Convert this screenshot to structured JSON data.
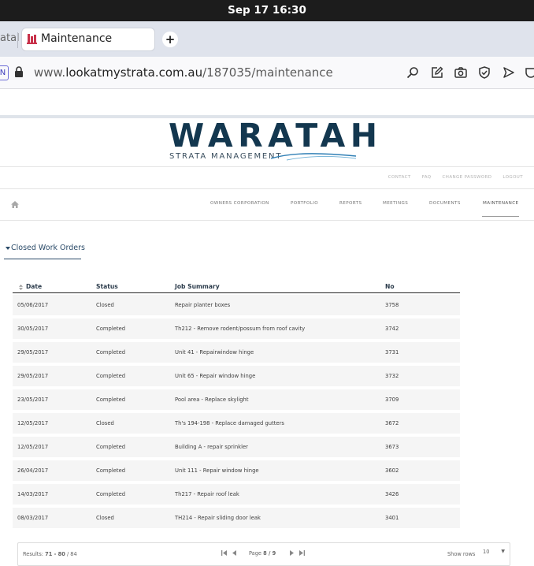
{
  "os": {
    "datetime": "Sep 17  16:30"
  },
  "browser": {
    "prev_tab_fragment": "atal",
    "active_tab_title": "Maintenance",
    "new_tab_symbol": "+",
    "url_prefix": "www.",
    "url_domain": "lookatmystrata.com.au",
    "url_path": "/187035/maintenance",
    "extension_badge": "N"
  },
  "brand": {
    "name": "WARATAH",
    "tagline": "STRATA MANAGEMENT",
    "accent": "#13374f"
  },
  "util_nav": [
    "CONTACT",
    "FAQ",
    "CHANGE PASSWORD",
    "LOGOUT"
  ],
  "main_nav": {
    "items": [
      "OWNERS CORPORATION",
      "PORTFOLIO",
      "REPORTS",
      "MEETINGS",
      "DOCUMENTS",
      "MAINTENANCE"
    ],
    "active": "MAINTENANCE"
  },
  "section": {
    "title": "Closed Work Orders"
  },
  "table": {
    "columns": [
      "Date",
      "Status",
      "Job Summary",
      "No"
    ],
    "rows": [
      [
        "05/06/2017",
        "Closed",
        "Repair planter boxes",
        "3758"
      ],
      [
        "30/05/2017",
        "Completed",
        "Th212 - Remove rodent/possum from roof cavity",
        "3742"
      ],
      [
        "29/05/2017",
        "Completed",
        "Unit 41 - Repairwindow hinge",
        "3731"
      ],
      [
        "29/05/2017",
        "Completed",
        "Unit 65 - Repair window hinge",
        "3732"
      ],
      [
        "23/05/2017",
        "Completed",
        "Pool area - Replace skylight",
        "3709"
      ],
      [
        "12/05/2017",
        "Closed",
        "Th's 194-198 - Replace damaged gutters",
        "3672"
      ],
      [
        "12/05/2017",
        "Completed",
        "Building A - repair sprinkler",
        "3673"
      ],
      [
        "26/04/2017",
        "Completed",
        "Unit 111 - Repair window hinge",
        "3602"
      ],
      [
        "14/03/2017",
        "Completed",
        "Th217 - Repair roof leak",
        "3426"
      ],
      [
        "08/03/2017",
        "Closed",
        "TH214 - Repair sliding door leak",
        "3401"
      ]
    ]
  },
  "pagination": {
    "results_label": "Results:",
    "results_range": "71 - 80",
    "results_total": "/ 84",
    "page_label": "Page",
    "page_value": "8 / 9",
    "show_rows_label": "Show rows",
    "rows_value": "10"
  }
}
